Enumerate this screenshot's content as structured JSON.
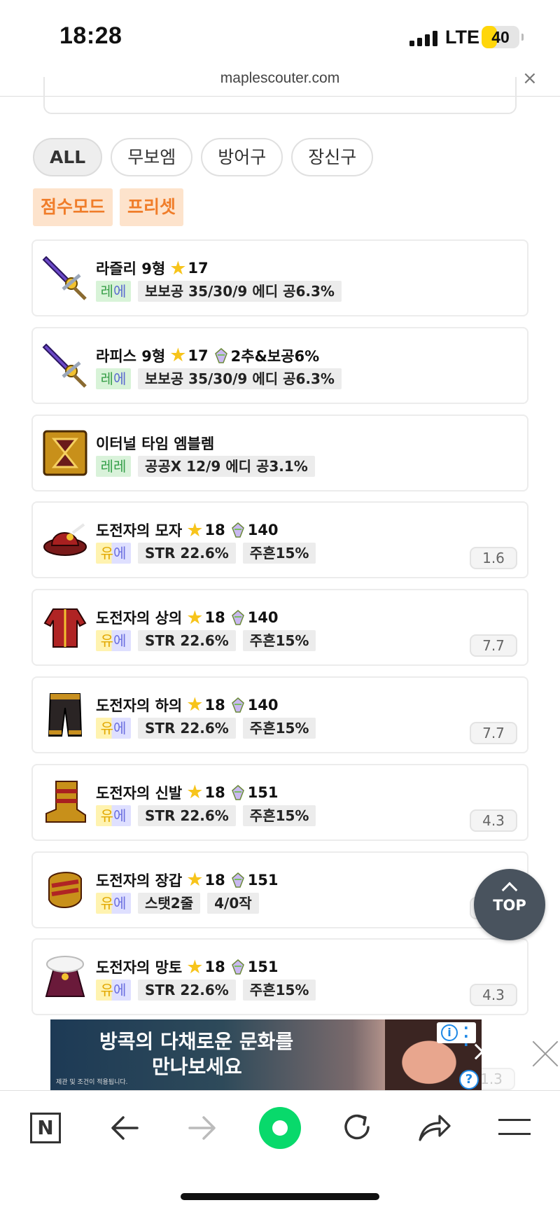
{
  "status": {
    "time": "18:28",
    "network": "LTE",
    "battery": "40",
    "battery_level": 0.4
  },
  "browser": {
    "url": "maplescouter.com",
    "close": "×"
  },
  "filters": [
    {
      "label": "ALL",
      "active": true
    },
    {
      "label": "무보엠",
      "active": false
    },
    {
      "label": "방어구",
      "active": false
    },
    {
      "label": "장신구",
      "active": false
    }
  ],
  "modes": [
    "점수모드",
    "프리셋"
  ],
  "items": [
    {
      "name": "라즐리 9형",
      "stars": "17",
      "potential": "",
      "grade": [
        "레",
        "에"
      ],
      "tags": [
        "보보공 35/30/9 에디 공6.3%"
      ],
      "score": "",
      "icon": "sword-icon"
    },
    {
      "name": "라피스 9형",
      "stars": "17",
      "potential": "2추&보공6%",
      "grade": [
        "레",
        "에"
      ],
      "tags": [
        "보보공 35/30/9 에디 공6.3%"
      ],
      "score": "",
      "icon": "sword-icon"
    },
    {
      "name": "이터널 타임 엠블렘",
      "stars": "",
      "potential": "",
      "grade": [
        "레",
        "레"
      ],
      "tags": [
        "공공X 12/9 에디 공3.1%"
      ],
      "score": "",
      "icon": "emblem-icon"
    },
    {
      "name": "도전자의 모자",
      "stars": "18",
      "potential": "140",
      "grade": [
        "유",
        "에"
      ],
      "tags": [
        "STR 22.6%",
        "주흔15%"
      ],
      "score": "1.6",
      "icon": "hat-icon"
    },
    {
      "name": "도전자의 상의",
      "stars": "18",
      "potential": "140",
      "grade": [
        "유",
        "에"
      ],
      "tags": [
        "STR 22.6%",
        "주흔15%"
      ],
      "score": "7.7",
      "icon": "top-icon"
    },
    {
      "name": "도전자의 하의",
      "stars": "18",
      "potential": "140",
      "grade": [
        "유",
        "에"
      ],
      "tags": [
        "STR 22.6%",
        "주흔15%"
      ],
      "score": "7.7",
      "icon": "pants-icon"
    },
    {
      "name": "도전자의 신발",
      "stars": "18",
      "potential": "151",
      "grade": [
        "유",
        "에"
      ],
      "tags": [
        "STR 22.6%",
        "주흔15%"
      ],
      "score": "4.3",
      "icon": "shoes-icon"
    },
    {
      "name": "도전자의 장갑",
      "stars": "18",
      "potential": "151",
      "grade": [
        "유",
        "에"
      ],
      "tags": [
        "스탯2줄",
        "4/0작"
      ],
      "score": "-31.4",
      "icon": "gloves-icon"
    },
    {
      "name": "도전자의 망토",
      "stars": "18",
      "potential": "151",
      "grade": [
        "유",
        "에"
      ],
      "tags": [
        "STR 22.6%",
        "주흔15%"
      ],
      "score": "4.3",
      "icon": "cape-icon"
    }
  ],
  "top_button": {
    "label": "TOP"
  },
  "ad": {
    "line1": "방콕의 다채로운 문화를",
    "line2": "만나보세요",
    "fine": "제관 및 조건이 적용됩니다.",
    "info": "i",
    "help": "?"
  },
  "peek_score": "1.3",
  "toolbar": {
    "n_label": "N"
  },
  "colors": {
    "accent_orange": "#f07d2a",
    "star": "#f7c41b",
    "green": "#08d96b"
  }
}
